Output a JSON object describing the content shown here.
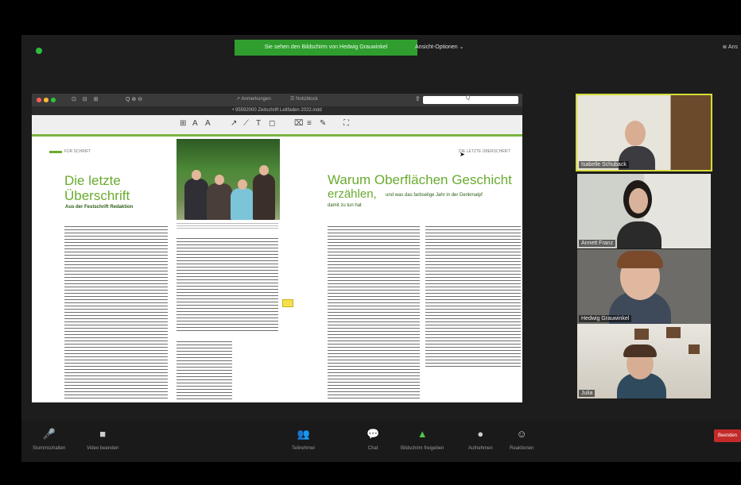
{
  "meeting": {
    "share_banner": "Sie sehen den Bildschirm von Hedwig Grauwinkel",
    "view_options": "Ansicht-Optionen ⌄",
    "speaker_view": "≣ Ans"
  },
  "shared_app": {
    "toolbar_tools": "⊡ ⊟ ⊞",
    "zoom": "Q ⊕ ⊖",
    "annotations_tab": "↗ Anmerkungen",
    "notes_tab": "☰ Notizblock",
    "search_icon": "Q",
    "share_icon": "⇪",
    "doc_title": "• 95592000 Zeitschrift Leitfaden 2022.indd",
    "markup_tools": [
      "⊞",
      "A",
      "A",
      "↗",
      "⟋",
      "T",
      "◻",
      "⌧",
      "≡",
      "✎",
      "⛶"
    ],
    "page": {
      "running_head_left": "FÜR SCHRIFT",
      "running_head_right": "DIE LETZTE ÜBERSCHRIFT",
      "heading_left_line1": "Die letzte",
      "heading_left_line2": "Überschrift",
      "subheading_left": "Aus der Festschrift Redaktion",
      "heading_right_line1": "Warum Oberflächen Geschicht",
      "heading_right_line2": "erzählen,",
      "heading_right_cont": "und was das farbselige Jahr in der Denkmalpf",
      "subheading_right": "damit zu tun hat"
    }
  },
  "participants": [
    {
      "name": "Isabelle Schuback",
      "active": true
    },
    {
      "name": "Annett Franz",
      "active": false
    },
    {
      "name": "Hedwig Grauwinkel",
      "active": false
    },
    {
      "name": "Julia",
      "active": false
    }
  ],
  "toolbar": {
    "buttons": [
      {
        "icon": "🎤",
        "label": "Stummschalten"
      },
      {
        "icon": "■",
        "label": "Video beenden"
      },
      {
        "icon": "👥",
        "label": "Teilnehmer"
      },
      {
        "icon": "💬",
        "label": "Chat"
      },
      {
        "icon": "▲",
        "label": "Bildschirm freigeben"
      },
      {
        "icon": "●",
        "label": "Aufnehmen"
      },
      {
        "icon": "☺",
        "label": "Reaktionen"
      }
    ],
    "end_label": "Beenden"
  },
  "colors": {
    "share_green": "#2f9e2f",
    "magazine_green": "#6aab2e",
    "active_speaker": "#d4dc3a",
    "end_red": "#c42a2a"
  }
}
